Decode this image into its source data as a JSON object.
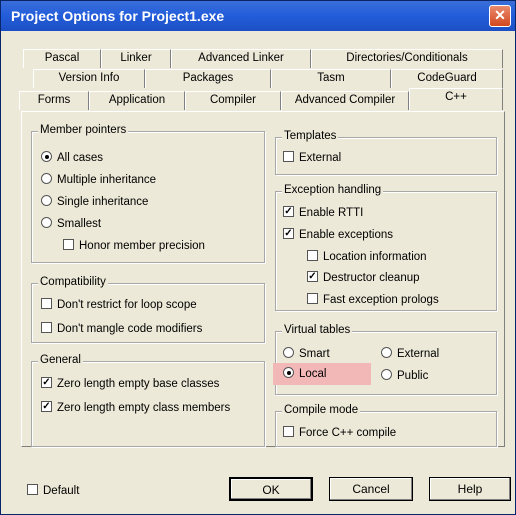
{
  "window": {
    "title": "Project Options for Project1.exe",
    "close_glyph": "✕"
  },
  "tabs": {
    "row1": [
      "Pascal",
      "Linker",
      "Advanced Linker",
      "Directories/Conditionals"
    ],
    "row2": [
      "Version Info",
      "Packages",
      "Tasm",
      "CodeGuard"
    ],
    "row3": [
      "Forms",
      "Application",
      "Compiler",
      "Advanced Compiler",
      "C++"
    ]
  },
  "member_pointers": {
    "label": "Member pointers",
    "options": [
      "All cases",
      "Multiple inheritance",
      "Single inheritance",
      "Smallest"
    ],
    "selected": 0,
    "honor": "Honor member precision"
  },
  "compatibility": {
    "label": "Compatibility",
    "options": [
      "Don't restrict for loop scope",
      "Don't mangle code modifiers"
    ]
  },
  "general": {
    "label": "General",
    "options": [
      "Zero length empty base classes",
      "Zero length empty class members"
    ]
  },
  "templates": {
    "label": "Templates",
    "external": "External"
  },
  "exception_handling": {
    "label": "Exception handling",
    "enable_rtti": "Enable RTTI",
    "enable_exceptions": "Enable exceptions",
    "location_information": "Location information",
    "destructor_cleanup": "Destructor cleanup",
    "fast_prologs": "Fast exception prologs"
  },
  "virtual_tables": {
    "label": "Virtual tables",
    "smart": "Smart",
    "external": "External",
    "local": "Local",
    "public": "Public"
  },
  "compile_mode": {
    "label": "Compile mode",
    "force_cpp": "Force C++ compile"
  },
  "check_mark": "✓",
  "bottom": {
    "default": "Default",
    "ok": "OK",
    "cancel": "Cancel",
    "help": "Help"
  }
}
